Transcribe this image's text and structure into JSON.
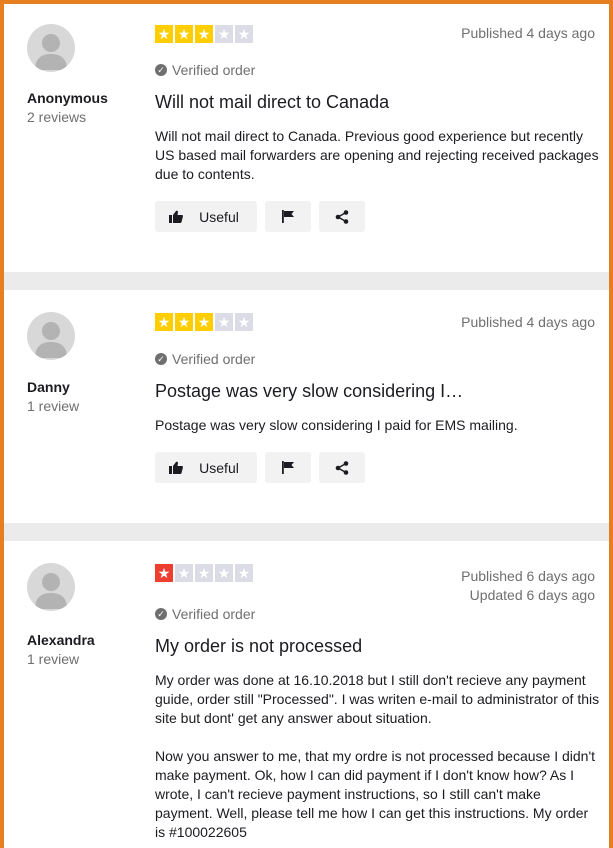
{
  "colors": {
    "star_green_fill": "#ffce00",
    "star_red_fill": "#ee3e2f",
    "star_empty": "#dcdce6",
    "border": "#e67e22"
  },
  "reviews": [
    {
      "name": "Anonymous",
      "review_count": "2 reviews",
      "rating": 3,
      "star_color": "#ffce00",
      "published": "Published 4 days ago",
      "updated": "",
      "verified": "Verified order",
      "title": "Will not mail direct to Canada",
      "body": [
        "Will not mail direct to Canada. Previous good experience but recently US based mail forwarders are opening and rejecting received packages due to contents."
      ],
      "useful_label": "Useful"
    },
    {
      "name": "Danny",
      "review_count": "1 review",
      "rating": 3,
      "star_color": "#ffce00",
      "published": "Published 4 days ago",
      "updated": "",
      "verified": "Verified order",
      "title": "Postage was very slow considering I…",
      "body": [
        "Postage was very slow considering I paid for EMS mailing."
      ],
      "useful_label": "Useful"
    },
    {
      "name": "Alexandra",
      "review_count": "1 review",
      "rating": 1,
      "star_color": "#ee3e2f",
      "published": "Published 6 days ago",
      "updated": "Updated 6 days ago",
      "verified": "Verified order",
      "title": "My order is not processed",
      "body": [
        "My order was done at 16.10.2018 but I still don't recieve any payment guide, order still \"Processed\". I was writen e-mail to administrator of this site but dont' get any answer about situation.",
        "Now you answer to me, that my ordre is not processed because I didn't make payment. Ok, how I can did payment if I don't know how? As I wrote, I can't recieve payment instructions, so I still can't make payment. Well, please tell me how I can get this instructions. My order is #100022605"
      ],
      "useful_label": ""
    }
  ]
}
